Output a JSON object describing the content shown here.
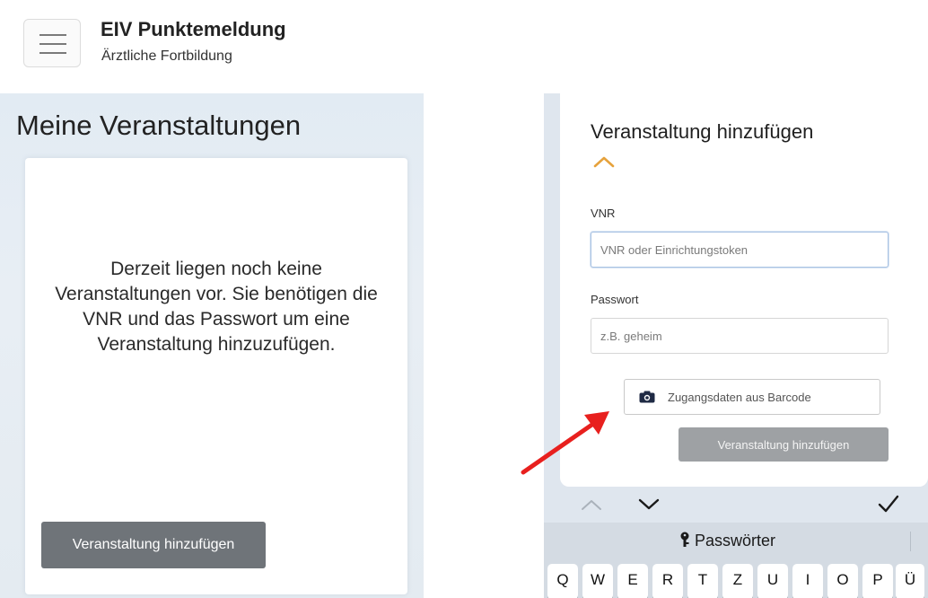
{
  "left_screen": {
    "header": {
      "title": "EIV Punktemeldung",
      "subtitle": "Ärztliche Fortbildung",
      "menu_icon": "hamburger-menu-icon"
    },
    "page_title": "Meine Veranstaltungen",
    "empty_message": "Derzeit liegen noch keine Veranstaltungen vor. Sie benötigen die VNR und das Passwort um eine Veranstaltung hinzuzufügen.",
    "add_button_label": "Veranstaltung hinzufügen"
  },
  "right_screen": {
    "form_title": "Veranstaltung hinzufügen",
    "collapse_icon": "chevron-up-icon",
    "vnr": {
      "label": "VNR",
      "placeholder": "VNR oder Einrichtungstoken"
    },
    "password": {
      "label": "Passwort",
      "placeholder": "z.B. geheim"
    },
    "barcode_button_label": "Zugangsdaten aus Barcode",
    "barcode_icon": "camera-icon",
    "submit_button_label": "Veranstaltung hinzufügen",
    "keyboard": {
      "toolbar_icons": [
        "chevron-up-icon",
        "chevron-down-icon",
        "checkmark-icon"
      ],
      "suggestion_label": "Passwörter",
      "suggestion_icon": "key-icon",
      "row1": [
        "Q",
        "W",
        "E",
        "R",
        "T",
        "Z",
        "U",
        "I",
        "O",
        "P",
        "Ü"
      ]
    }
  },
  "colors": {
    "annotation_arrow": "#e8201e",
    "chevron_accent": "#e6a23c",
    "primary_button_left": "#6f7479",
    "primary_button_right_disabled": "#9ea1a4",
    "camera_icon": "#1f2a44"
  },
  "annotation": {
    "type": "arrow",
    "points_to": "barcode-button"
  }
}
